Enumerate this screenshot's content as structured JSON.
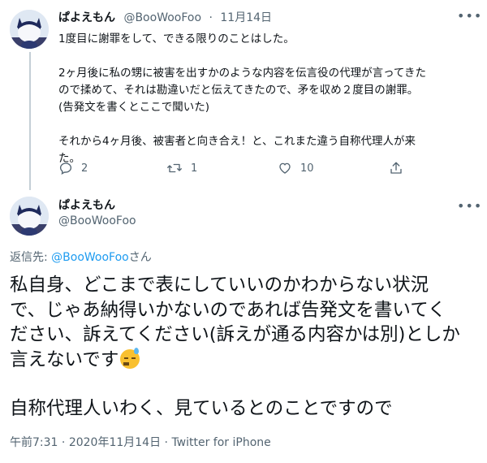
{
  "tweet1": {
    "display_name": "ぱよえもん",
    "handle": "@BooWooFoo",
    "separator": "·",
    "date": "11月14日",
    "more_icon": "more-horizontal-icon",
    "paragraphs": [
      [
        "1度目に謝罪をして、できる限りのことはした。"
      ],
      [
        "2ヶ月後に私の甥に被害を出すかのような内容を伝言役の代理が言ってきた",
        "ので揉めて、それは勘違いだと伝えてきたので、矛を収め２度目の謝罪。",
        "(告発文を書くとここで聞いた)"
      ],
      [
        "それから4ヶ月後、被害者と向き合え！と、これまた違う自称代理人が来",
        "た。"
      ]
    ],
    "actions": {
      "reply_icon": "reply-icon",
      "reply_count": "2",
      "retweet_icon": "retweet-icon",
      "retweet_count": "1",
      "like_icon": "like-icon",
      "like_count": "10",
      "share_icon": "share-icon"
    }
  },
  "tweet2": {
    "display_name": "ぱよえもん",
    "handle": "@BooWooFoo",
    "more_icon": "more-horizontal-icon",
    "replying_prefix": "返信先: ",
    "replying_handle": "@BooWooFoo",
    "replying_suffix": "さん",
    "lines": [
      "私自身、どこまで表にしていいのかわからない状況",
      "で、じゃあ納得いかないのであれば告発文を書いてく",
      "ださい、訴えてください(訴えが通る内容かは別)としか",
      "言えないです"
    ],
    "emoji": "downcast-face-with-sweat-emoji",
    "last_line": "自称代理人いわく、見ているとのことですので",
    "time": "午前7:31",
    "separator": "·",
    "date": "2020年11月14日",
    "separator2": "·",
    "source": "Twitter for iPhone"
  },
  "colors": {
    "accent": "#1d9bf0",
    "muted": "#536471",
    "text": "#0f1419",
    "thread_line": "#c4cfd6"
  }
}
